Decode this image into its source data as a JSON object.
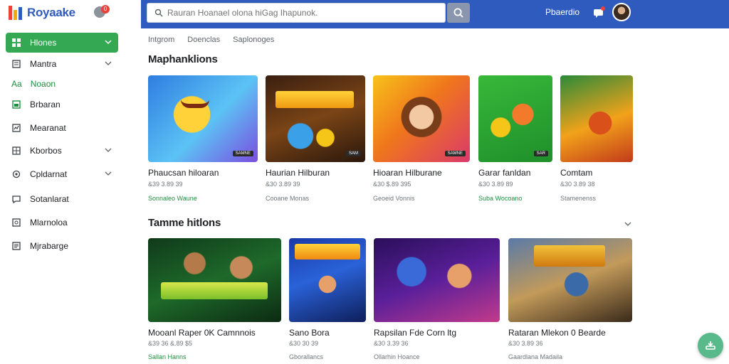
{
  "app": {
    "name": "Royaake",
    "notification_count": "0"
  },
  "search": {
    "placeholder": "Rauran Hoanael olona hiGag Ihapunok."
  },
  "header": {
    "link": "Pbaerdio"
  },
  "colors": {
    "brand_blue": "#2f5bbf",
    "active_green": "#34a853",
    "accent_red": "#e8433a",
    "fab": "#58b98a"
  },
  "sidebar": {
    "items": [
      {
        "label": "Hlones",
        "icon": "grid-icon",
        "active": true,
        "chevron": true
      },
      {
        "label": "Mantra",
        "icon": "book-icon",
        "active": false,
        "chevron": true
      },
      {
        "label": "Noaon",
        "icon_text": "Aa",
        "active": false,
        "chevron": false
      },
      {
        "label": "Brbaran",
        "icon": "square-icon",
        "active": false,
        "chevron": false
      },
      {
        "label": "Mearanat",
        "icon": "chart-icon",
        "active": false,
        "chevron": false
      },
      {
        "label": "Kborbos",
        "icon": "folder-icon",
        "active": false,
        "chevron": true
      },
      {
        "label": "Cpldarnat",
        "icon": "settings-icon",
        "active": false,
        "chevron": true
      },
      {
        "label": "Sotanlarat",
        "icon": "chat-icon",
        "active": false,
        "chevron": false
      },
      {
        "label": "Mlarnoloa",
        "icon": "image-icon",
        "active": false,
        "chevron": false
      },
      {
        "label": "Mjrabarge",
        "icon": "list-icon",
        "active": false,
        "chevron": false
      }
    ]
  },
  "tabs": [
    "Intgrom",
    "Doenclas",
    "Saplonoges"
  ],
  "sections": [
    {
      "title": "Maphanklions",
      "cards": [
        {
          "title": "Phaucsan hiloaran",
          "meta": "&39 3.89 39",
          "sub": "Sonnaleo Waune",
          "sub_color": "green",
          "art": "emoji",
          "tag": "SAMNE"
        },
        {
          "title": "Haurian Hilburan",
          "meta": "&30 3.89 39",
          "sub": "Cooane Monas",
          "sub_color": "gray",
          "art": "nabens",
          "tag": "SAM"
        },
        {
          "title": "Hioaran Hilburane",
          "meta": "&30 $.89 395",
          "sub": "Geoeid Vonnis",
          "sub_color": "gray",
          "art": "girl",
          "tag": "SAMNE"
        },
        {
          "title": "Garar fanldan",
          "meta": "&30 3.89 89",
          "sub": "Suba Wocoano",
          "sub_color": "green",
          "art": "toys",
          "tag": "SAR"
        },
        {
          "title": "Comtam",
          "meta": "&30 3.89 38",
          "sub": "Stamenenss",
          "sub_color": "gray",
          "art": "guitar",
          "tag": ""
        }
      ]
    },
    {
      "title": "Tamme hitlons",
      "cards": [
        {
          "title": "Mooanl Raper 0K Camnnois",
          "meta": "&39 36 &.89 $5",
          "sub": "Sallan Hanns",
          "sub_color": "green",
          "art": "mowaran",
          "tag": ""
        },
        {
          "title": "Sano Bora",
          "meta": "&30 30 39",
          "sub": "Gborallancs",
          "sub_color": "gray",
          "art": "klowfam",
          "tag": ""
        },
        {
          "title": "Rapsilan Fde Corn ltg",
          "meta": "&30 3.39 36",
          "sub": "Ollarhin Hoance",
          "sub_color": "gray",
          "art": "disco",
          "tag": ""
        },
        {
          "title": "Rataran Mlekon 0 Bearde",
          "meta": "&30 3.89 36",
          "sub": "Gaardlana Madaila",
          "sub_color": "gray",
          "art": "heist",
          "tag": ""
        }
      ]
    }
  ]
}
